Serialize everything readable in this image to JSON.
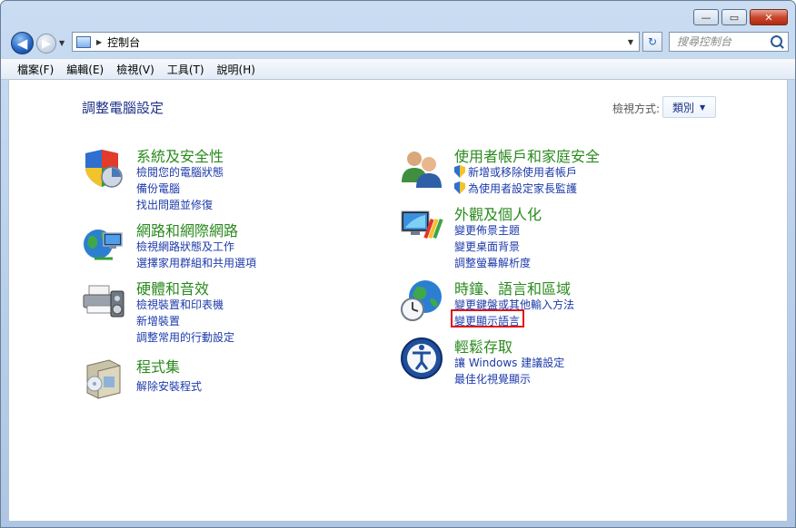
{
  "window": {
    "caption_buttons": {
      "minimize": "—",
      "maximize": "▭",
      "close": "✕"
    }
  },
  "navbar": {
    "back_glyph": "◀",
    "forward_glyph": "▶",
    "dropdown_glyph": "▼",
    "address": "控制台",
    "address_sep": "▶",
    "refresh_glyph": "↻",
    "search_placeholder": "搜尋控制台"
  },
  "menubar": {
    "items": [
      "檔案(F)",
      "編輯(E)",
      "檢視(V)",
      "工具(T)",
      "說明(H)"
    ]
  },
  "main": {
    "title": "調整電腦設定",
    "view_by_label": "檢視方式:",
    "view_by_value": "類別",
    "view_by_arrow": "▼",
    "categories": [
      {
        "title": "系統及安全性",
        "links": [
          "檢閱您的電腦狀態",
          "備份電腦",
          "找出問題並修復"
        ]
      },
      {
        "title": "網路和網際網路",
        "links": [
          "檢視網路狀態及工作",
          "選擇家用群組和共用選項"
        ]
      },
      {
        "title": "硬體和音效",
        "links": [
          "檢視裝置和印表機",
          "新增裝置",
          "調整常用的行動設定"
        ]
      },
      {
        "title": "程式集",
        "links": [
          "解除安裝程式"
        ]
      },
      {
        "title": "使用者帳戶和家庭安全",
        "links": [
          "新增或移除使用者帳戶",
          "為使用者設定家長監護"
        ]
      },
      {
        "title": "外觀及個人化",
        "links": [
          "變更佈景主題",
          "變更桌面背景",
          "調整螢幕解析度"
        ]
      },
      {
        "title": "時鐘、語言和區域",
        "links": [
          "變更鍵盤或其他輸入方法",
          "變更顯示語言"
        ]
      },
      {
        "title": "輕鬆存取",
        "links": [
          "讓 Windows 建議設定",
          "最佳化視覺顯示"
        ]
      }
    ]
  },
  "icons": {
    "system": "shield-icon",
    "network": "globe-network-icon",
    "hardware": "printer-icon",
    "programs": "programs-box-icon",
    "users": "users-icon",
    "appearance": "monitor-palette-icon",
    "clock": "globe-clock-icon",
    "ease": "ease-of-access-icon"
  },
  "colors": {
    "category_title": "#2b8a1e",
    "link": "#1c3aa9",
    "heading": "#1e3287",
    "highlight": "#e0101a"
  }
}
